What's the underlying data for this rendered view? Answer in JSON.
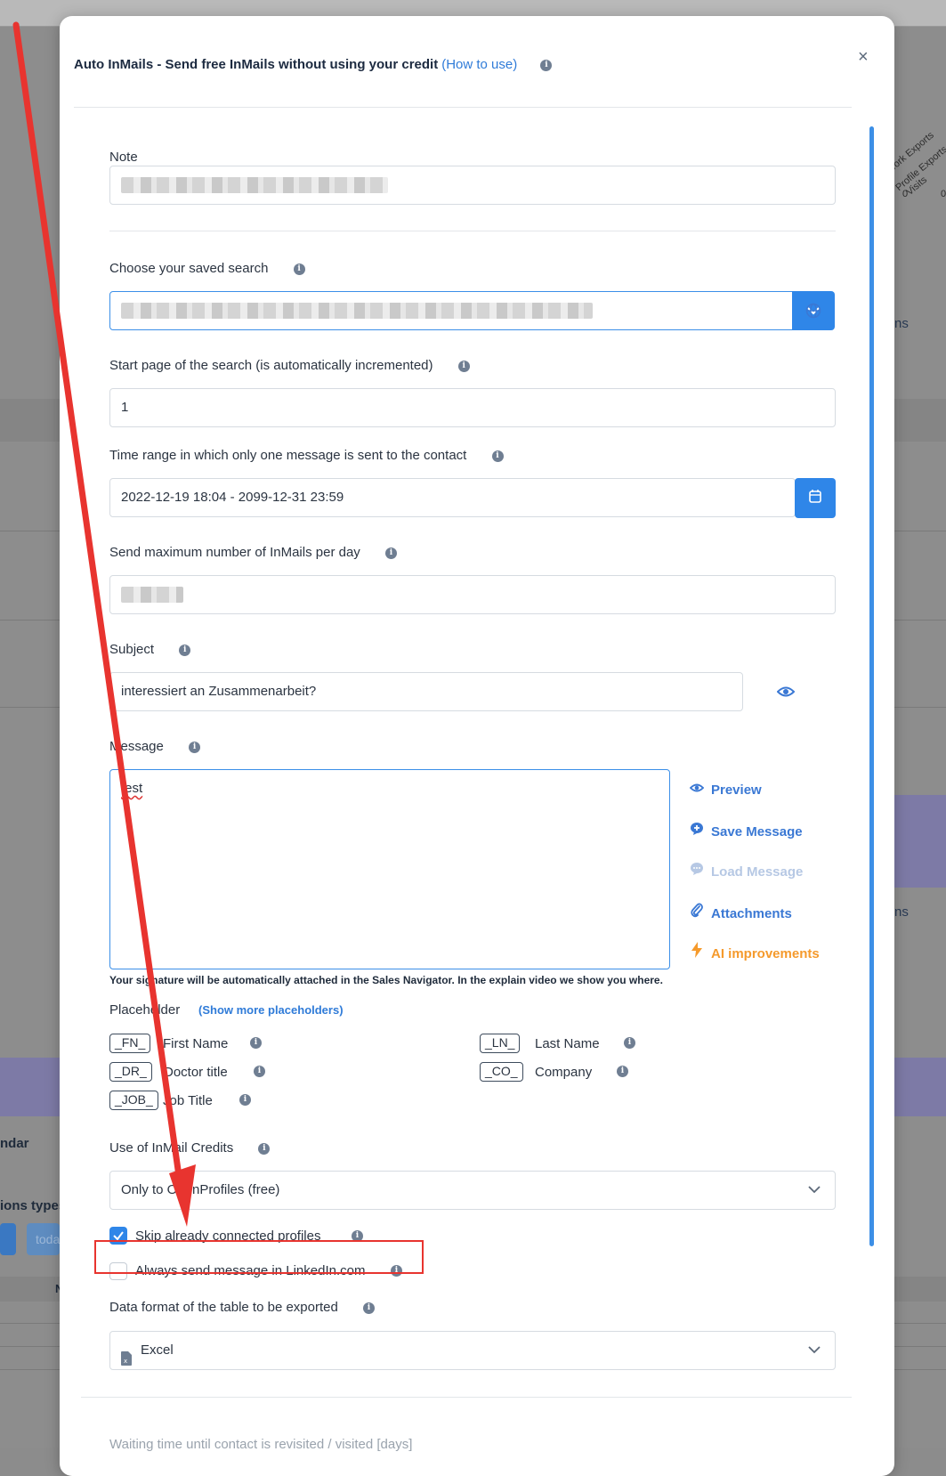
{
  "background": {
    "rotated_headers": [
      "Network Exports",
      "Profile Exports",
      "Visits"
    ],
    "zeros": [
      "0",
      "0"
    ],
    "side_labels": [
      "ns",
      "ns"
    ],
    "left_labels": [
      "ndar",
      "ions types"
    ],
    "today_button": "toda",
    "col_letter": "N"
  },
  "modal": {
    "title": "Auto InMails - Send free InMails without using your credit",
    "how_to_use": "(How to use)",
    "close": "×"
  },
  "fields": {
    "note_label": "Note",
    "saved_search_label": "Choose your saved search",
    "start_page_label": "Start page of the search (is automatically incremented)",
    "start_page_value": "1",
    "time_range_label": "Time range in which only one message is sent to the contact",
    "time_range_value": "2022-12-19 18:04 - 2099-12-31 23:59",
    "max_inmails_label": "Send maximum number of InMails per day",
    "subject_label": "Subject",
    "subject_value": "interessiert an Zusammenarbeit?",
    "message_label": "Message",
    "message_value": "test"
  },
  "actions": {
    "preview": "Preview",
    "save_message": "Save Message",
    "load_message": "Load Message",
    "attachments": "Attachments",
    "ai_improvements": "AI improvements"
  },
  "signature_note": "Your signature will be automatically attached in the Sales Navigator. In the explain video we show you where.",
  "placeholders": {
    "label": "Placeholder",
    "show_more": "(Show more placeholders)",
    "items": [
      {
        "tag": "_FN_",
        "name": "First Name"
      },
      {
        "tag": "_LN_",
        "name": "Last Name"
      },
      {
        "tag": "_DR_",
        "name": "Doctor title"
      },
      {
        "tag": "_CO_",
        "name": "Company"
      },
      {
        "tag": "_JOB_",
        "name": "Job Title"
      }
    ]
  },
  "inmail_credits": {
    "label": "Use of InMail Credits",
    "value": "Only to OpenProfiles (free)"
  },
  "checkboxes": {
    "skip_connected": "Skip already connected profiles",
    "skip_connected_checked": true,
    "always_linkedin": "Always send message in LinkedIn.com",
    "always_linkedin_checked": false
  },
  "export": {
    "label": "Data format of the table to be exported",
    "value": "Excel"
  },
  "bottom_label_partial": "Waiting time until contact is revisited / visited [days]",
  "colors": {
    "primary": "#2f86e8",
    "accent_orange": "#f59a2c",
    "annotation_red": "#e8342f"
  }
}
